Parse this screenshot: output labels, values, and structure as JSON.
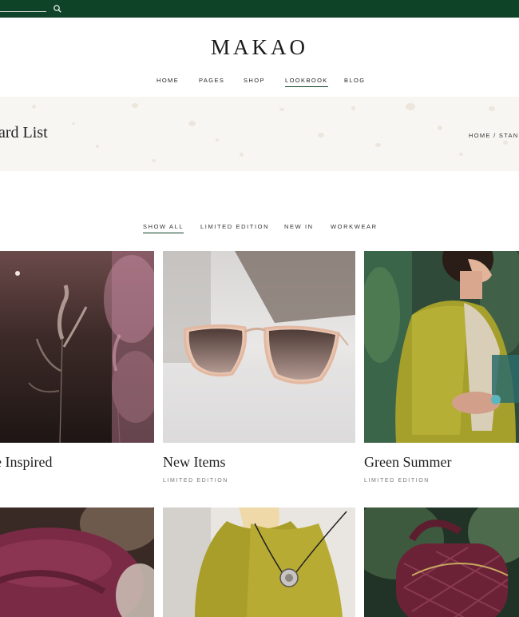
{
  "brand": {
    "logo": "MAKAO"
  },
  "nav": [
    "HOME",
    "PAGES",
    "SHOP",
    "LOOKBOOK",
    "BLOG"
  ],
  "banner": {
    "title": "ard List",
    "breadcrumb": "HOME / STAND"
  },
  "filters": [
    "SHOW ALL",
    "LIMITED EDITION",
    "NEW IN",
    "WORKWEAR"
  ],
  "cards": [
    {
      "title": "e Inspired",
      "category": ""
    },
    {
      "title": "New Items",
      "category": "LIMITED EDITION"
    },
    {
      "title": "Green Summer",
      "category": "LIMITED EDITION"
    }
  ],
  "colors": {
    "topbar": "#0f4327",
    "banner": "#f8f6f2",
    "accent": "#0f4327"
  },
  "icons": {
    "search": "search-icon"
  }
}
